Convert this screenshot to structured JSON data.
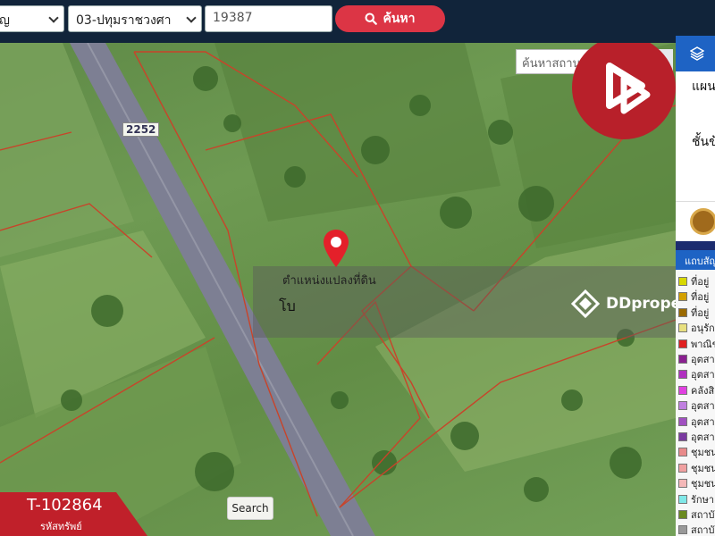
{
  "toolbar": {
    "province_value": "ญ",
    "district_value": "03-ปทุมราชวงศา",
    "id_value": "19387",
    "search_label": "ค้นหา"
  },
  "map": {
    "road_number": "2252",
    "place_search_placeholder": "ค้นหาสถานที่สำ",
    "pin_label": "ตำแหน่งแปลงที่ดิน",
    "band_text": "โบ",
    "watermark": "DDproperty",
    "listing_code": "T-102864",
    "listing_code_caption": "รหัสทรัพย์",
    "search_button": "Search"
  },
  "panel": {
    "line1": "แผน",
    "line2": "ชั้นข้",
    "legend_title": "แถบสัญ",
    "legend": [
      {
        "label": "ที่อยู่",
        "color": "#d8d800"
      },
      {
        "label": "ที่อยู่",
        "color": "#d4a000"
      },
      {
        "label": "ที่อยู่",
        "color": "#9a6a00"
      },
      {
        "label": "อนุรัก",
        "color": "#e8e080"
      },
      {
        "label": "พาณิช",
        "color": "#e02020"
      },
      {
        "label": "อุตสา",
        "color": "#8a2090"
      },
      {
        "label": "อุตสา",
        "color": "#b030c0"
      },
      {
        "label": "คลังสิ",
        "color": "#e040e0"
      },
      {
        "label": "อุตสา",
        "color": "#c080e0"
      },
      {
        "label": "อุตสา",
        "color": "#a050c0"
      },
      {
        "label": "อุตสา",
        "color": "#7a3aa0"
      },
      {
        "label": "ชุมชน",
        "color": "#e88a8a"
      },
      {
        "label": "ชุมชน",
        "color": "#f0a0a0"
      },
      {
        "label": "ชุมชน",
        "color": "#f4b8b8"
      },
      {
        "label": "รักษา",
        "color": "#80e8e8"
      },
      {
        "label": "สถาบั",
        "color": "#6a8a20"
      },
      {
        "label": "สถาบั",
        "color": "#999999"
      }
    ]
  }
}
